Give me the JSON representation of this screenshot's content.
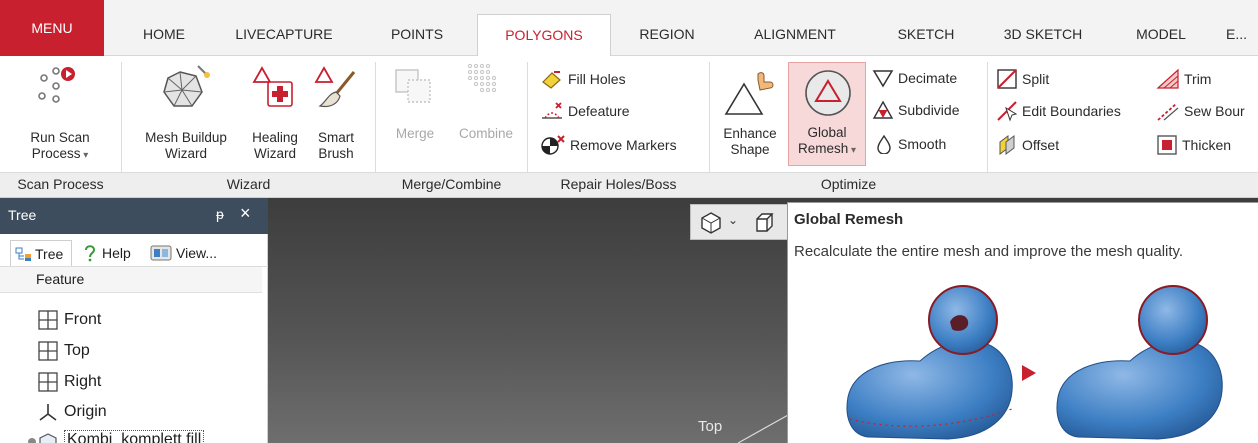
{
  "tabs": [
    {
      "label": "MENU"
    },
    {
      "label": "HOME"
    },
    {
      "label": "LIVECAPTURE"
    },
    {
      "label": "POINTS"
    },
    {
      "label": "POLYGONS"
    },
    {
      "label": "REGION"
    },
    {
      "label": "ALIGNMENT"
    },
    {
      "label": "SKETCH"
    },
    {
      "label": "3D SKETCH"
    },
    {
      "label": "MODEL"
    },
    {
      "label": "E..."
    }
  ],
  "ribbon": {
    "scan_process": {
      "run_scan_line1": "Run Scan",
      "run_scan_line2": "Process",
      "group": "Scan Process"
    },
    "wizard": {
      "mesh_line1": "Mesh Buildup",
      "mesh_line2": "Wizard",
      "healing_line1": "Healing",
      "healing_line2": "Wizard",
      "smart_line1": "Smart",
      "smart_line2": "Brush",
      "group": "Wizard"
    },
    "merge": {
      "merge": "Merge",
      "combine": "Combine",
      "group": "Merge/Combine"
    },
    "repair": {
      "fill_holes": "Fill Holes",
      "defeature": "Defeature",
      "remove_markers": "Remove Markers",
      "group": "Repair Holes/Boss"
    },
    "optimize": {
      "enhance_line1": "Enhance",
      "enhance_line2": "Shape",
      "global_line1": "Global",
      "global_line2": "Remesh",
      "decimate": "Decimate",
      "subdivide": "Subdivide",
      "smooth": "Smooth",
      "group": "Optimize"
    },
    "edit": {
      "split": "Split",
      "edit_boundaries": "Edit Boundaries",
      "offset": "Offset",
      "trim": "Trim",
      "sew_boundary": "Sew Bour",
      "thicken": "Thicken"
    }
  },
  "panel": {
    "title": "Tree",
    "pin": "ᵽ",
    "close": "×",
    "tabs": [
      {
        "label": "Tree"
      },
      {
        "label": "Help"
      },
      {
        "label": "View..."
      }
    ],
    "feature_header": "Feature",
    "items": [
      {
        "label": "Front"
      },
      {
        "label": "Top"
      },
      {
        "label": "Right"
      },
      {
        "label": "Origin"
      },
      {
        "label": "Kombi_komplett fill"
      }
    ]
  },
  "viewport": {
    "view_label": "Top"
  },
  "tooltip": {
    "title": "Global Remesh",
    "description": "Recalculate the entire mesh and improve the mesh quality."
  },
  "colors": {
    "accent": "#c8202f",
    "panel_header": "#3e4d5e",
    "mesh_blue": "#3d7fc4"
  }
}
